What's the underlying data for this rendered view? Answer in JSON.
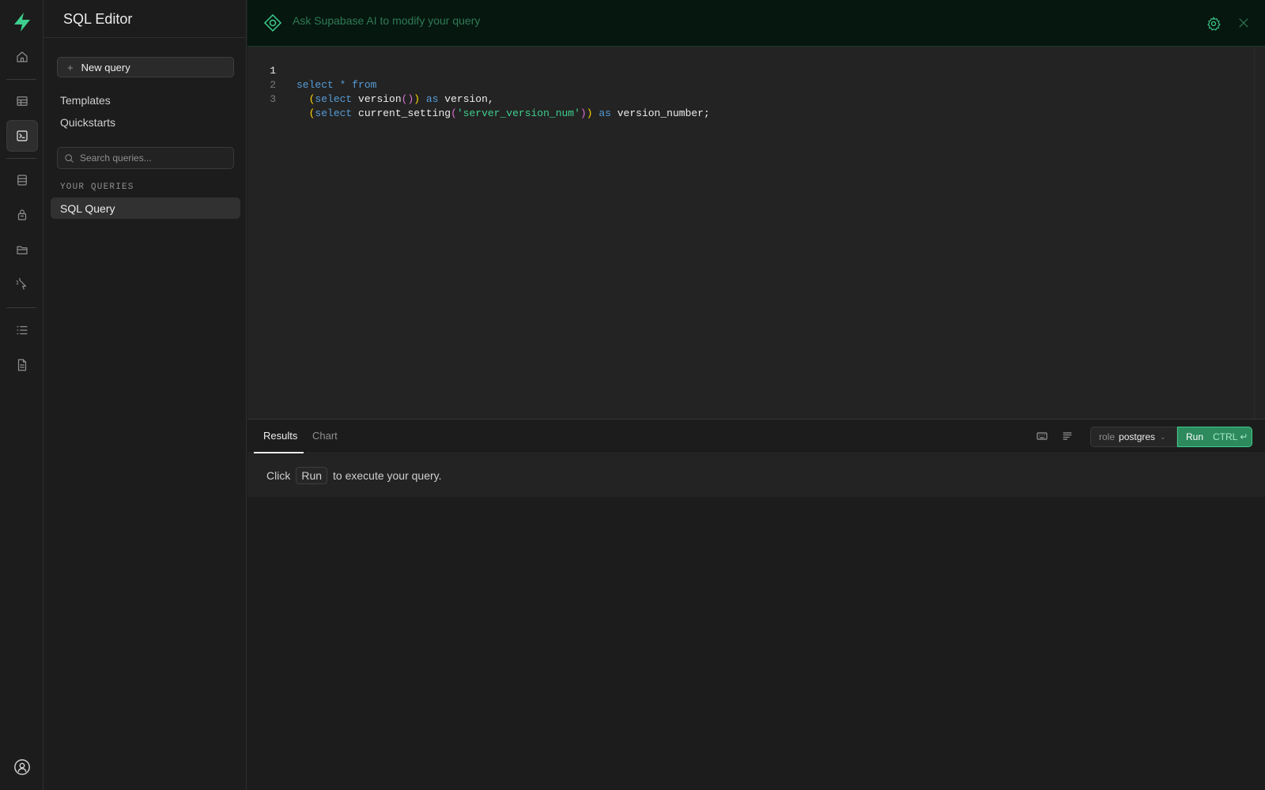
{
  "sidebar": {
    "title": "SQL Editor",
    "new_query_label": "New query",
    "links": [
      "Templates",
      "Quickstarts"
    ],
    "search_placeholder": "Search queries...",
    "section_label": "YOUR QUERIES",
    "queries": [
      "SQL Query"
    ]
  },
  "ai_bar": {
    "placeholder": "Ask Supabase AI to modify your query"
  },
  "editor": {
    "line_numbers": [
      "1",
      "2",
      "3"
    ],
    "lines": [
      "select * from",
      "  (select version()) as version,",
      "  (select current_setting('server_version_num')) as version_number;"
    ]
  },
  "results": {
    "tabs": [
      "Results",
      "Chart"
    ],
    "role_key": "role",
    "role_value": "postgres",
    "run_label": "Run",
    "run_shortcut": "CTRL ↵",
    "message_prefix": "Click",
    "message_run": "Run",
    "message_suffix": "to execute your query."
  },
  "colors": {
    "brand": "#3ecf8e",
    "background": "#1c1c1c",
    "editor_bg": "#232323"
  },
  "icons": {
    "rail": [
      "home-icon",
      "table-editor-icon",
      "sql-editor-icon",
      "database-icon",
      "auth-icon",
      "storage-icon",
      "edge-functions-icon",
      "logs-icon",
      "reports-icon",
      "user-profile-icon"
    ]
  }
}
